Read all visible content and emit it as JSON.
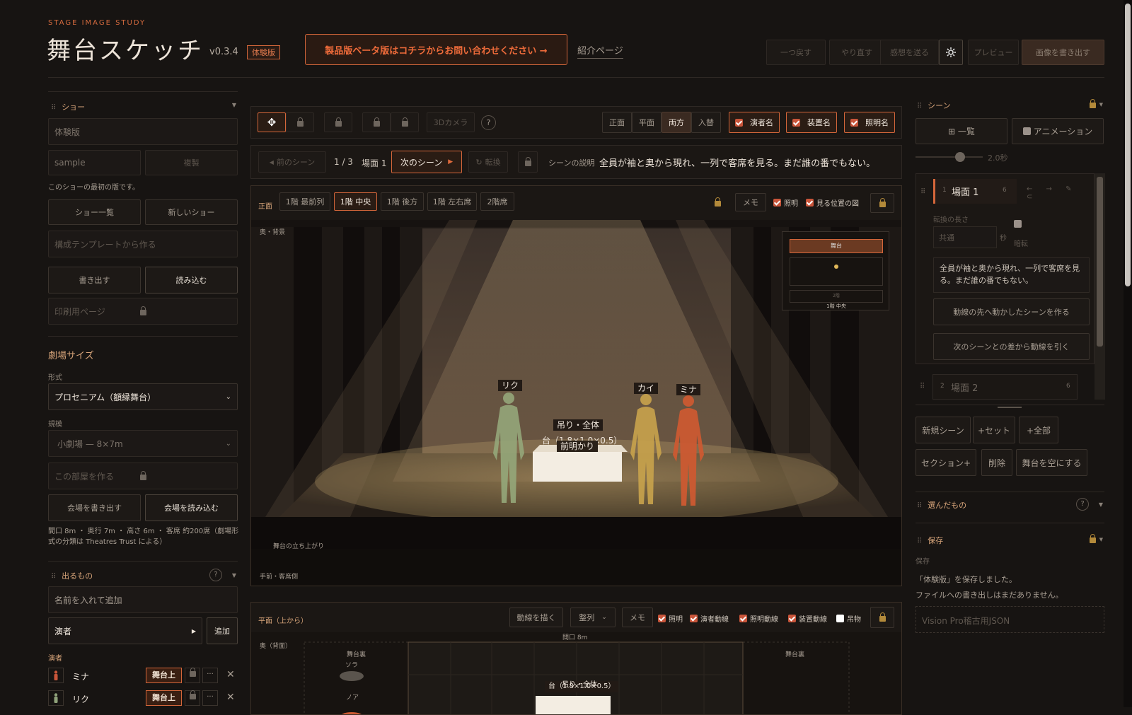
{
  "header": {
    "subtitle": "STAGE IMAGE STUDY",
    "title": "舞台スケッチ",
    "version": "v0.3.4",
    "badge": "体験版",
    "promo": "製品版ベータ版はコチラからお問い合わせください →",
    "intro_link": "紹介ページ",
    "toolbar": {
      "undo": "一つ戻す",
      "redo": "やり直す",
      "feedback": "感想を送る",
      "plugin": "プレビュー",
      "export": "画像を書き出す"
    }
  },
  "left": {
    "show": {
      "title": "ショー",
      "name_value": "体験版",
      "version_value": "sample",
      "copy_label": "複製",
      "note": "このショーの最初の版です。",
      "list_btn": "ショー一覧",
      "new_btn": "新しいショー",
      "template_placeholder": "構成テンプレートから作る",
      "export_btn": "書き出す",
      "import_btn": "読み込む",
      "print_label": "印刷用ページ"
    },
    "theater": {
      "title": "劇場サイズ",
      "format_label": "形式",
      "format_value": "プロセニアム（額縁舞台）",
      "scale_label": "規模",
      "scale_value": "小劇場 — 8×7m",
      "make_room": "この部屋を作る",
      "export_venue": "会場を書き出す",
      "import_venue": "会場を読み込む",
      "spec": "間口 8m ・ 奥行 7m ・ 高さ 6m ・ 客席 約200席（劇場形式の分類は Theatres Trust による）"
    },
    "cast": {
      "title": "出るもの",
      "add_placeholder": "名前を入れて追加",
      "type_value": "演者",
      "add_btn": "追加",
      "group_label": "演者",
      "members": [
        {
          "name": "ミナ",
          "status": "舞台上",
          "color": "#c9553a"
        },
        {
          "name": "リク",
          "status": "舞台上",
          "color": "#8fa27a"
        }
      ]
    }
  },
  "stage": {
    "toolbar": {
      "camera_btn": "3Dカメラ",
      "help": "?",
      "views": [
        "正面",
        "平面",
        "両方",
        "入替"
      ],
      "active_view": "両方",
      "toggles": [
        {
          "label": "演者名",
          "checked": true
        },
        {
          "label": "装置名",
          "checked": true
        },
        {
          "label": "照明名",
          "checked": true
        }
      ]
    },
    "scene_nav": {
      "prev": "前のシーン",
      "counter": "1 / 3",
      "scene": "場面 1",
      "next": "次のシーン",
      "transition": "転換",
      "desc_label": "シーンの説明",
      "description": "全員が袖と奥から現れ、一列で客席を見る。まだ誰の番でもない。"
    },
    "front": {
      "label": "正面",
      "seats": [
        "1階 最前列",
        "1階 中央",
        "1階 後方",
        "1階 左右席",
        "2階席"
      ],
      "active_seat": "1階 中央",
      "memo": "メモ",
      "light_chk": "照明",
      "mini_chk": "見る位置の図",
      "back_label": "奥・背景",
      "apron_label": "舞台の立ち上がり",
      "audience_label": "手前・客席側",
      "actors": [
        {
          "name": "リク",
          "color": "#95a77a"
        },
        {
          "name": "カイ",
          "color": "#c7a24c"
        },
        {
          "name": "ミナ",
          "color": "#cc5a32"
        }
      ],
      "props": {
        "hang": "吊り・全体",
        "platform": "台（1.8×1.0×0.5）",
        "light": "前明かり"
      },
      "minimap": {
        "stage": "舞台",
        "balcony": "2階",
        "seat": "1階 中央"
      }
    },
    "plan": {
      "label": "平面（上から）",
      "draw_btn": "動線を描く",
      "align_value": "整列",
      "memo": "メモ",
      "toggles": [
        {
          "label": "照明",
          "checked": true
        },
        {
          "label": "演者動線",
          "checked": true
        },
        {
          "label": "照明動線",
          "checked": true
        },
        {
          "label": "装置動線",
          "checked": true
        },
        {
          "label": "吊物",
          "checked": false
        }
      ],
      "back_label": "奥（背面）",
      "wing_left": "舞台裏",
      "wing_right": "舞台裏",
      "width_label": "間口 8m",
      "actor1": "ソラ",
      "actor2": "ノア",
      "platform": "台（1.8×1.0×0.5）",
      "hang": "吊り・全体"
    }
  },
  "right": {
    "scenes": {
      "title": "シーン",
      "list_btn": "⊞ 一覧",
      "anim_label": "アニメーション",
      "duration": "2.0秒",
      "scene1": {
        "num": "1",
        "name": "場面 1",
        "count": "6",
        "transition_label": "転換の長さ",
        "transition_placeholder": "共通",
        "unit": "秒",
        "blackout": "暗転",
        "description": "全員が袖と奥から現れ、一列で客席を見る。まだ誰の番でもない。",
        "action1": "動線の先へ動かしたシーンを作る",
        "action2": "次のシーンとの差から動線を引く"
      },
      "scene2": {
        "num": "2",
        "name": "場面 2",
        "count": "6"
      },
      "buttons": [
        "新規シーン",
        "+セット",
        "+全部",
        "セクション+",
        "削除",
        "舞台を空にする"
      ]
    },
    "selected": {
      "title": "選んだもの",
      "help": "?"
    },
    "save": {
      "title": "保存",
      "label": "保存",
      "msg1": "「体験版」を保存しました。",
      "msg2": "ファイルへの書き出しはまだありません。",
      "vision_btn": "Vision Pro稽古用JSON"
    }
  }
}
